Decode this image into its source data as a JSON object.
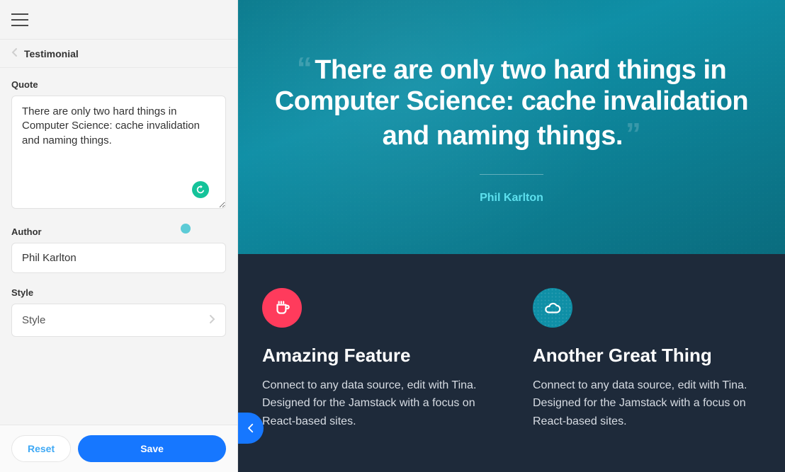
{
  "sidebar": {
    "breadcrumb": "Testimonial",
    "fields": {
      "quote_label": "Quote",
      "quote_value": "There are only two hard things in Computer Science: cache invalidation and naming things.",
      "author_label": "Author",
      "author_value": "Phil Karlton",
      "style_label": "Style",
      "style_value": "Style"
    },
    "footer": {
      "reset_label": "Reset",
      "save_label": "Save"
    }
  },
  "preview": {
    "hero": {
      "quote": "There are only two hard things in Computer Science: cache invalidation and naming things.",
      "author": "Phil Karlton"
    },
    "features": [
      {
        "icon": "coffee-icon",
        "icon_color": "red",
        "title": "Amazing Feature",
        "body": "Connect to any data source, edit with Tina. Designed for the Jamstack with a focus on React-based sites."
      },
      {
        "icon": "cloud-icon",
        "icon_color": "blue",
        "title": "Another Great Thing",
        "body": "Connect to any data source, edit with Tina. Designed for the Jamstack with a focus on React-based sites."
      }
    ]
  }
}
